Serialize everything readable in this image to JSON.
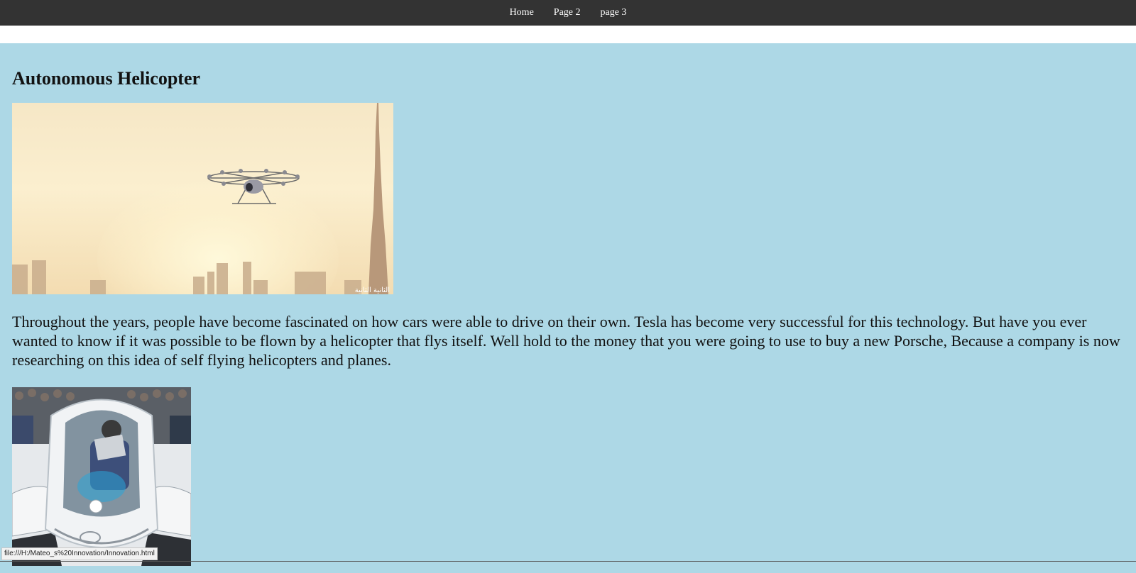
{
  "nav": {
    "items": [
      {
        "label": "Home"
      },
      {
        "label": "Page 2"
      },
      {
        "label": "page 3"
      }
    ]
  },
  "main": {
    "heading": "Autonomous Helicopter",
    "paragraph": "Throughout the years, people have become fascinated on how cars were able to drive on their own. Tesla has become very successful for this technology. But have you ever wanted to know if it was possible to be flown by a helicopter that flys itself. Well hold to the money that you were going to use to buy a new Porsche, Because a company is now researching on this idea of self flying helicopters and planes.",
    "image1_watermark": "الثانية الثانية"
  },
  "status_bar": {
    "url": "file:///H:/Mateo_s%20Innovation/Innovation.html"
  },
  "colors": {
    "page_background": "#add8e6",
    "nav_background": "#333333",
    "nav_text": "#ffffff"
  }
}
